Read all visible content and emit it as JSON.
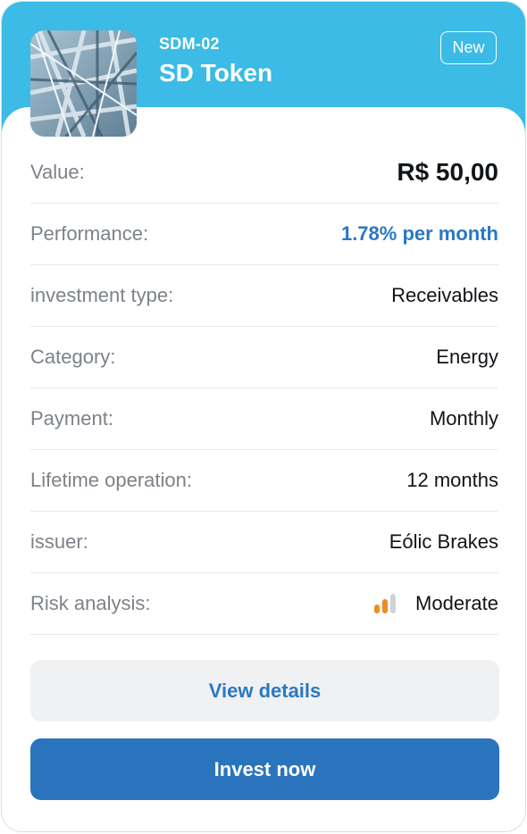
{
  "card": {
    "code": "SDM-02",
    "title": "SD Token",
    "badge": "New",
    "image": "steel-structure-photo"
  },
  "details": [
    {
      "label": "Value:",
      "value": "R$ 50,00"
    },
    {
      "label": "Performance:",
      "value": "1.78% per month"
    },
    {
      "label": "investment type:",
      "value": "Receivables"
    },
    {
      "label": "Category:",
      "value": "Energy"
    },
    {
      "label": "Payment:",
      "value": "Monthly"
    },
    {
      "label": "Lifetime operation:",
      "value": "12 months"
    },
    {
      "label": "issuer:",
      "value": "Eólic Brakes"
    },
    {
      "label": "Risk analysis:",
      "value": "Moderate",
      "icon": "signal-bars-icon",
      "level": "2 of 3"
    }
  ],
  "actions": {
    "view_details": "View details",
    "invest_now": "Invest now"
  },
  "colors": {
    "header": "#3bbbe6",
    "accent": "#2a78c3",
    "primary_button": "#2a74bd",
    "risk_active": "#f08a24",
    "risk_inactive": "#cfd3d8"
  }
}
